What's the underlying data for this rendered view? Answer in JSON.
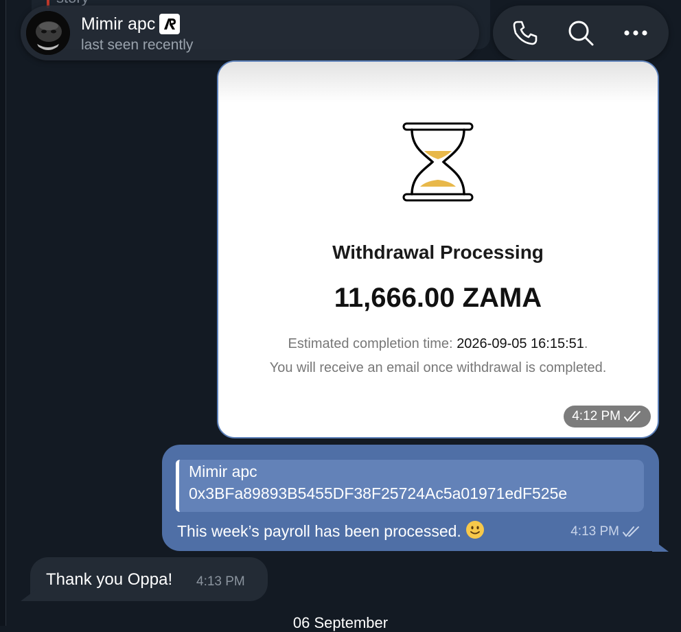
{
  "background_color": "#131a23",
  "previous_message": {
    "text": "story"
  },
  "header": {
    "contact_name": "Mimir apc",
    "status": "last seen recently",
    "badge_icon": "ar-badge-icon",
    "actions": [
      {
        "name": "call",
        "icon": "phone-icon"
      },
      {
        "name": "search",
        "icon": "search-icon"
      },
      {
        "name": "more",
        "icon": "ellipsis-icon"
      }
    ]
  },
  "messages": {
    "image_message": {
      "screenshot": {
        "title": "Withdrawal Processing",
        "amount": "11,666.00 ZAMA",
        "desc_prefix": "Estimated completion time:",
        "desc_time": "2026-09-05 16:15:51",
        "desc_suffix": ".",
        "desc_line2": "You will receive an email once withdrawal is completed."
      },
      "time": "4:12 PM",
      "status_icon": "double-check-icon"
    },
    "outgoing_reply": {
      "quote_author": "Mimir apc",
      "quote_text": "0x3BFa89893B5455DF38F25724Ac5a01971edF525e",
      "text": "This week’s payroll has been processed.",
      "emoji": "slightly-smiling-face",
      "time": "4:13 PM",
      "status_icon": "double-check-icon"
    },
    "incoming": {
      "text": "Thank you Oppa!",
      "time": "4:13 PM"
    }
  },
  "date_separator": "06 September",
  "colors": {
    "outgoing_bubble": "#4f6fa6",
    "incoming_bubble": "#232b35",
    "hourglass_sand": "#e8b84a"
  }
}
